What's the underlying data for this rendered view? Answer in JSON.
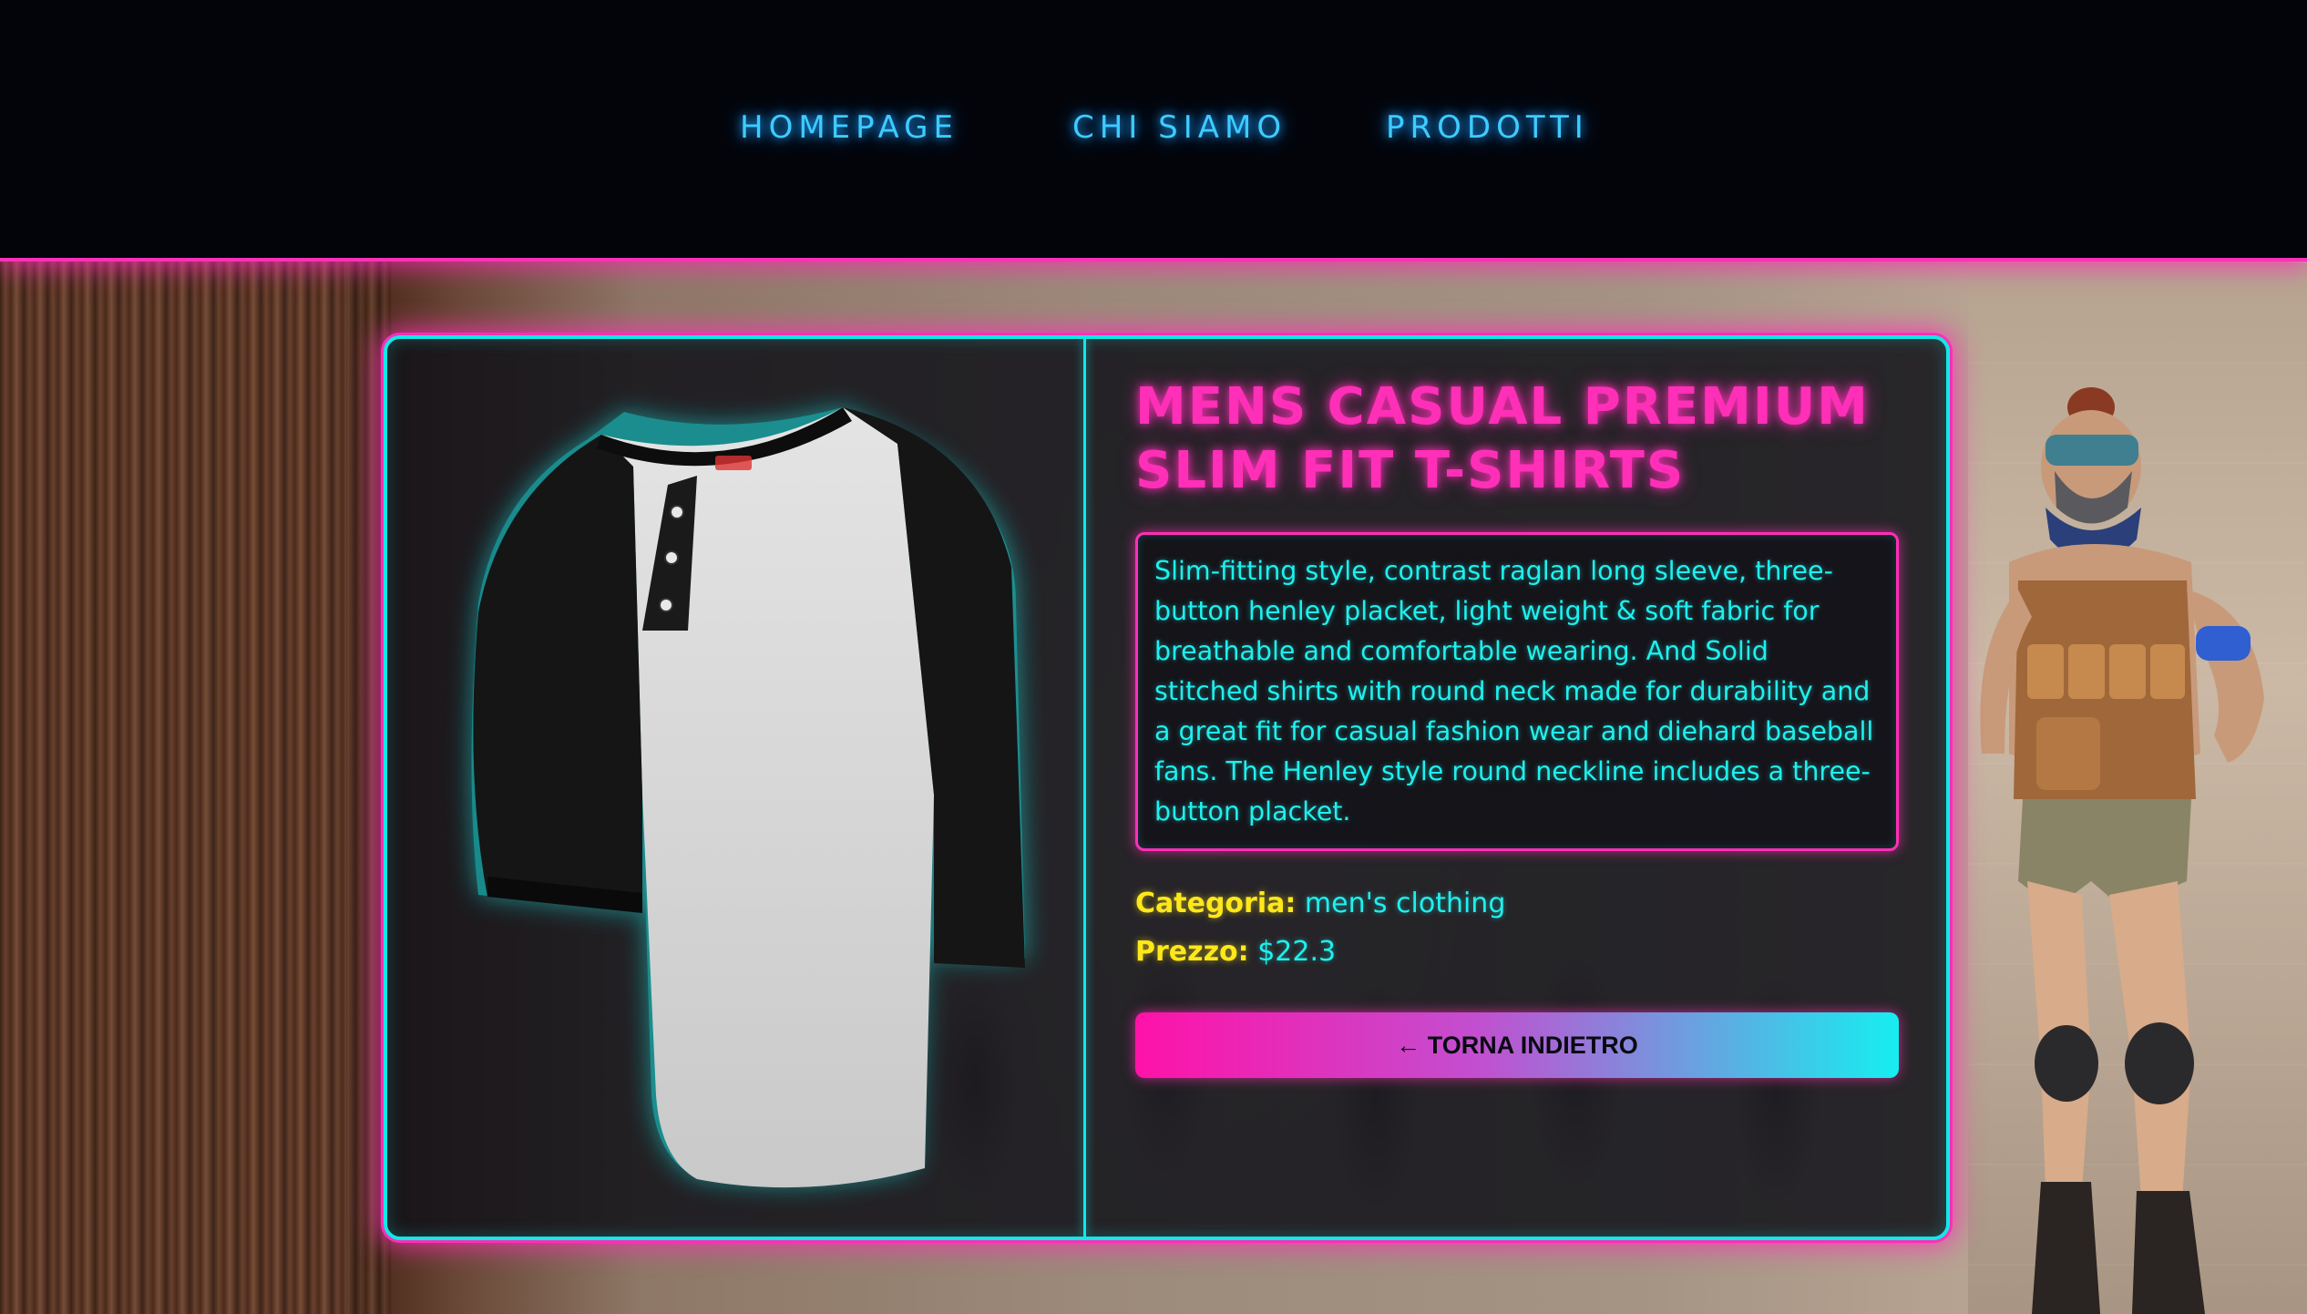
{
  "nav": {
    "items": [
      {
        "label": "HOMEPAGE"
      },
      {
        "label": "CHI SIAMO"
      },
      {
        "label": "PRODOTTI"
      }
    ]
  },
  "product": {
    "title": "MENS CASUAL PREMIUM SLIM FIT T-SHIRTS",
    "description": "Slim-fitting style, contrast raglan long sleeve, three-button henley placket, light weight & soft fabric for breathable and comfortable wearing. And Solid stitched shirts with round neck made for durability and a great fit for casual fashion wear and diehard baseball fans. The Henley style round neckline includes a three-button placket.",
    "category_label": "Categoria:",
    "category_value": "men's clothing",
    "price_label": "Prezzo:",
    "price_value": "$22.3",
    "image_icon": "henley-raglan-shirt-image"
  },
  "actions": {
    "back_label": "← TORNA INDIETRO"
  },
  "theme": {
    "neon_pink": "#ff2fb8",
    "neon_cyan": "#14e7e7",
    "nav_blue": "#3ecbff",
    "label_yellow": "#ffe81a",
    "navbar_bg": "#03040a"
  }
}
